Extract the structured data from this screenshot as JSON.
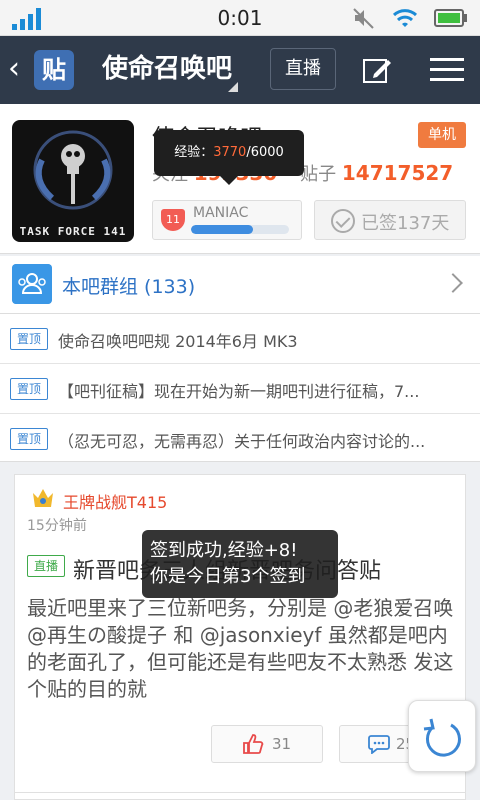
{
  "status_bar": {
    "time": "0:01"
  },
  "header": {
    "logo_text": "贴",
    "forum_title": "使命召唤吧",
    "live_button": "直播"
  },
  "forum_info": {
    "avatar_caption": "TASK FORCE 141",
    "name": "使命召唤吧",
    "category_badge": "单机",
    "follow_label": "关注",
    "follow_count": "192330",
    "posts_label": "贴子",
    "posts_count": "14717527",
    "level_number": "11",
    "level_name": "MANIAC",
    "level_progress": 0.63,
    "sign_label": "已签137天"
  },
  "exp_tooltip": {
    "label": "经验：",
    "current": "3770",
    "total": "/6000"
  },
  "group": {
    "label": "本吧群组 (133)"
  },
  "pinned": [
    {
      "tag": "置顶",
      "text": "使命召唤吧吧规 2014年6月 MK3"
    },
    {
      "tag": "置顶",
      "text": "【吧刊征稿】现在开始为新一期吧刊进行征稿，7..."
    },
    {
      "tag": "置顶",
      "text": "（忍无可忍，无需再忍）关于任何政治内容讨论的..."
    }
  ],
  "post": {
    "author": "王牌战舰T415",
    "time": "15分钟前",
    "tag": "直播",
    "title": "新晋吧务三人组新晋吧务问答贴",
    "body": "最近吧里来了三位新吧务，分别是 @老狼爱召唤 @再生の酸提子 和 @jasonxieyf 虽然都是吧内的老面孔了，但可能还是有些吧友不太熟悉 发这个贴的目的就",
    "likes": "31",
    "replies": "253"
  },
  "toast": {
    "line1": "签到成功,经验+8!",
    "line2": "你是今日第3个签到"
  },
  "colors": {
    "header_bg": "#2f3a4a",
    "accent_blue": "#3b86d3",
    "accent_orange": "#f35e2a"
  }
}
